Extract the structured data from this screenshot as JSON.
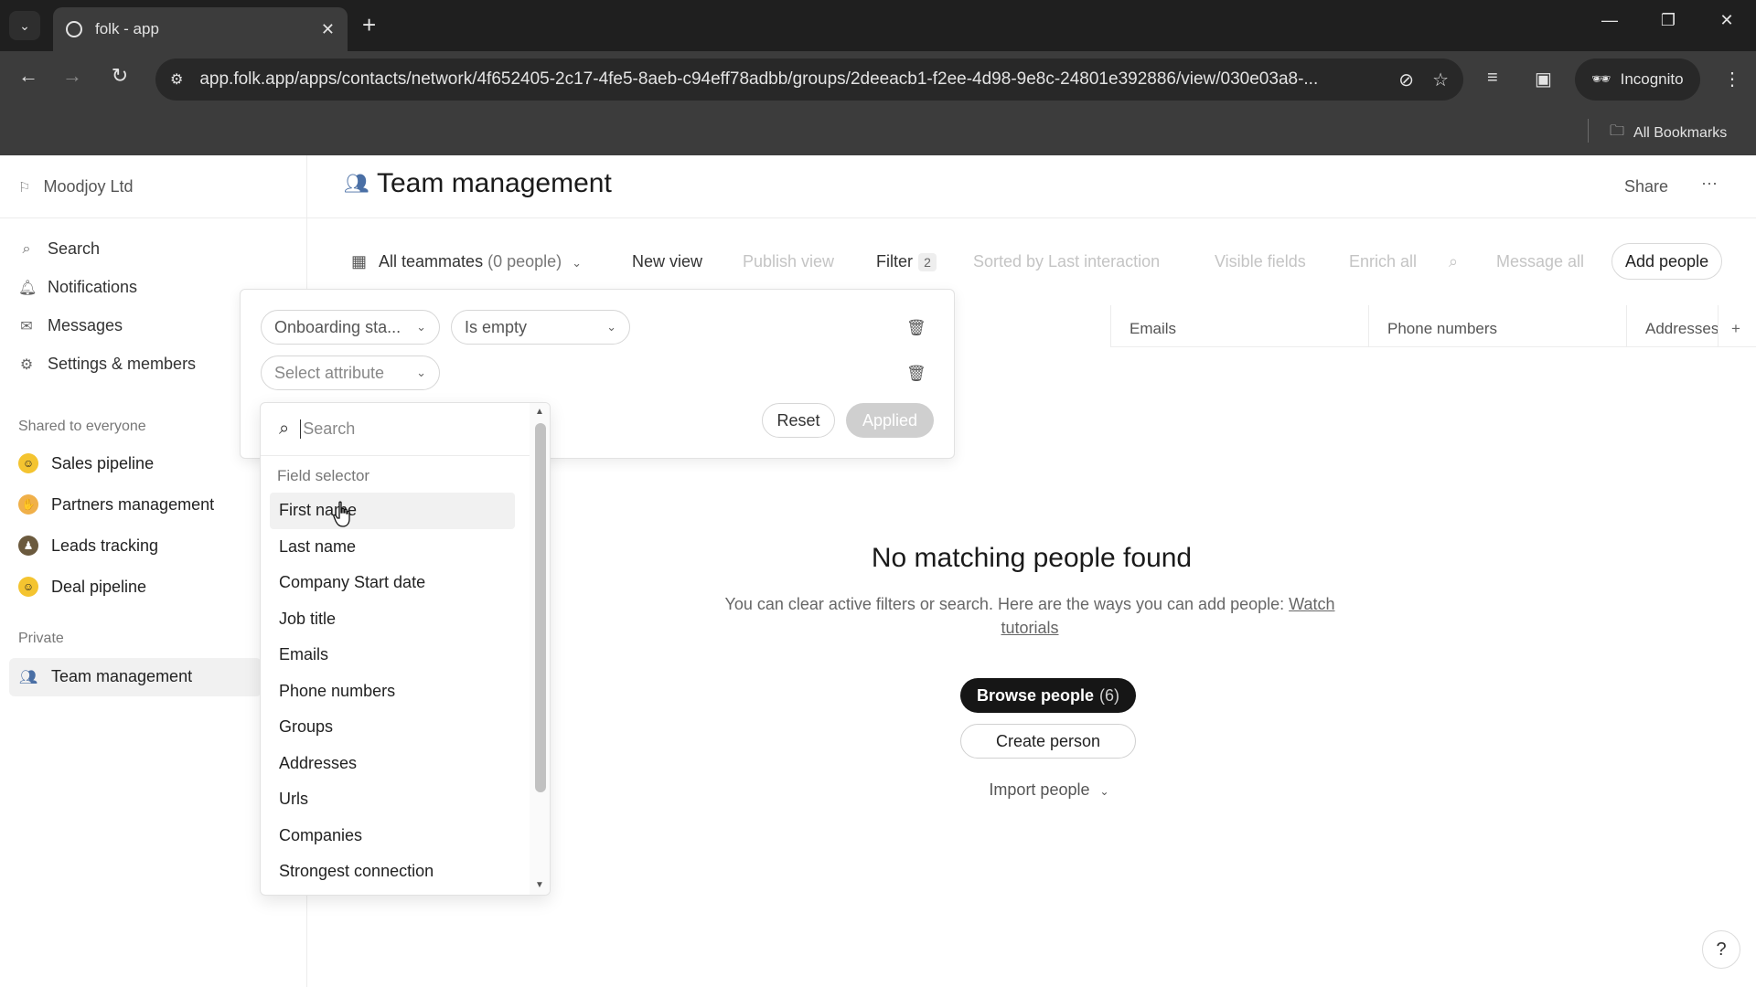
{
  "browser": {
    "tab_title": "folk - app",
    "url": "app.folk.app/apps/contacts/network/4f652405-2c17-4fe5-8aeb-c94eff78adbb/groups/2deeacb1-f2ee-4d98-9e8c-24801e392886/view/030e03a8-...",
    "incognito_label": "Incognito",
    "bookmarks_label": "All Bookmarks"
  },
  "sidebar": {
    "workspace": "Moodjoy Ltd",
    "nav": [
      {
        "label": "Search",
        "icon": "search-icon"
      },
      {
        "label": "Notifications",
        "icon": "bell-icon"
      },
      {
        "label": "Messages",
        "icon": "mail-icon"
      },
      {
        "label": "Settings & members",
        "icon": "gear-icon"
      }
    ],
    "shared_title": "Shared to everyone",
    "shared_groups": [
      {
        "label": "Sales pipeline",
        "icon": "grin-emoji-icon"
      },
      {
        "label": "Partners management",
        "icon": "handshake-emoji-icon"
      },
      {
        "label": "Leads tracking",
        "icon": "detective-emoji-icon"
      },
      {
        "label": "Deal pipeline",
        "icon": "smile-emoji-icon"
      }
    ],
    "private_title": "Private",
    "private_groups": [
      {
        "label": "Team management",
        "icon": "people-icon"
      }
    ]
  },
  "header": {
    "title": "Team management",
    "share_label": "Share"
  },
  "viewbar": {
    "view_name": "All teammates",
    "view_count": "(0 people)",
    "new_view": "New view",
    "publish_view": "Publish view",
    "filter_label": "Filter",
    "filter_count": "2",
    "sorted_label": "Sorted by Last interaction",
    "visible_fields": "Visible fields",
    "enrich_all": "Enrich all",
    "message_all": "Message all",
    "add_people": "Add people"
  },
  "columns": [
    "Emails",
    "Phone numbers",
    "Addresses"
  ],
  "filter": {
    "row1_attribute": "Onboarding sta...",
    "row1_operator": "Is empty",
    "row2_attribute": "Select attribute",
    "reset_label": "Reset",
    "applied_label": "Applied"
  },
  "attribute_dropdown": {
    "search_placeholder": "Search",
    "section_title": "Field selector",
    "items": [
      "First name",
      "Last name",
      "Company Start date",
      "Job title",
      "Emails",
      "Phone numbers",
      "Groups",
      "Addresses",
      "Urls",
      "Companies",
      "Strongest connection"
    ],
    "hovered_index": 0
  },
  "empty_state": {
    "title": "No matching people found",
    "subtitle": "You can clear active filters or search. Here are the ways you can add people:",
    "link": "Watch tutorials",
    "browse_label": "Browse people",
    "browse_count": "(6)",
    "create_label": "Create person",
    "import_label": "Import people"
  },
  "help_label": "?"
}
